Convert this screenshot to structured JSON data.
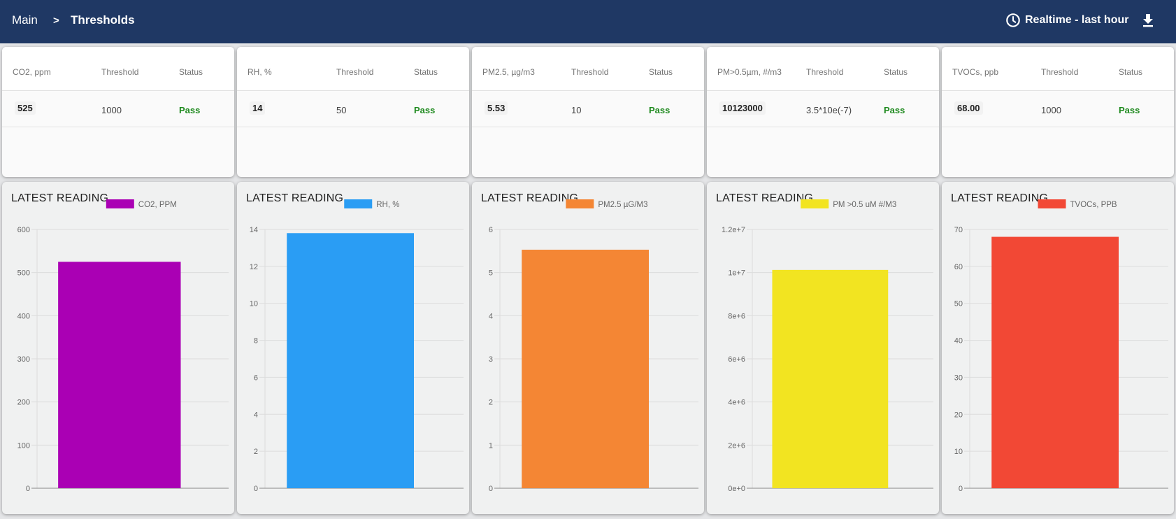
{
  "header": {
    "breadcrumb": [
      {
        "label": "Main"
      },
      {
        "label": ">"
      },
      {
        "label": "Thresholds"
      }
    ],
    "time_range_label": "Realtime - last hour",
    "time_range_icon": "clock-icon",
    "download_icon": "download-icon"
  },
  "threshold_cards": [
    {
      "metric": "CO2, ppm",
      "threshold_header": "Threshold",
      "status_header": "Status",
      "reading": "525",
      "threshold": "1000",
      "status": "Pass"
    },
    {
      "metric": "RH, %",
      "threshold_header": "Threshold",
      "status_header": "Status",
      "reading": "14",
      "threshold": "50",
      "status": "Pass"
    },
    {
      "metric": "PM2.5, µg/m3",
      "threshold_header": "Threshold",
      "status_header": "Status",
      "reading": "5.53",
      "threshold": "10",
      "status": "Pass"
    },
    {
      "metric": "PM>0.5µm, #/m3",
      "threshold_header": "Threshold",
      "status_header": "Status",
      "reading": "10123000",
      "threshold": "3.5*10e(-7)",
      "status": "Pass"
    },
    {
      "metric": "TVOCs, ppb",
      "threshold_header": "Threshold",
      "status_header": "Status",
      "reading": "68.00",
      "threshold": "1000",
      "status": "Pass"
    }
  ],
  "colors": {
    "header_bg": "#1f3864",
    "pass": "#1e8a1e",
    "grid": "#dcdcdc",
    "axis": "#888888"
  },
  "chart_data": [
    {
      "type": "bar",
      "title": "LATEST READING",
      "legend": "CO2, PPM",
      "legend_position": "top",
      "color": "#aa00b4",
      "categories": [
        ""
      ],
      "values": [
        525
      ],
      "ylim": [
        0,
        600
      ],
      "yticks": [
        "0",
        "100",
        "200",
        "300",
        "400",
        "500",
        "600"
      ],
      "ytick_values": [
        0,
        100,
        200,
        300,
        400,
        500,
        600
      ],
      "grid": true
    },
    {
      "type": "bar",
      "title": "LATEST READING",
      "legend": "RH, %",
      "legend_position": "top",
      "color": "#2a9df4",
      "categories": [
        ""
      ],
      "values": [
        13.8
      ],
      "ylim": [
        0,
        14
      ],
      "yticks": [
        "0",
        "2",
        "4",
        "6",
        "8",
        "10",
        "12",
        "14"
      ],
      "ytick_values": [
        0,
        2,
        4,
        6,
        8,
        10,
        12,
        14
      ],
      "grid": true
    },
    {
      "type": "bar",
      "title": "LATEST READING",
      "legend": "PM2.5 µG/M3",
      "legend_position": "top",
      "color": "#f48634",
      "categories": [
        ""
      ],
      "values": [
        5.53
      ],
      "ylim": [
        0,
        6
      ],
      "yticks": [
        "0",
        "1",
        "2",
        "3",
        "4",
        "5",
        "6"
      ],
      "ytick_values": [
        0,
        1,
        2,
        3,
        4,
        5,
        6
      ],
      "grid": true
    },
    {
      "type": "bar",
      "title": "LATEST READING",
      "legend": "PM >0.5 uM #/M3",
      "legend_position": "top",
      "color": "#f2e421",
      "categories": [
        ""
      ],
      "values": [
        10123000
      ],
      "ylim": [
        0,
        12000000
      ],
      "yticks": [
        "0e+0",
        "2e+6",
        "4e+6",
        "6e+6",
        "8e+6",
        "1e+7",
        "1.2e+7"
      ],
      "ytick_values": [
        0,
        2000000,
        4000000,
        6000000,
        8000000,
        10000000,
        12000000
      ],
      "grid": true
    },
    {
      "type": "bar",
      "title": "LATEST READING",
      "legend": "TVOCs, PPB",
      "legend_position": "top",
      "color": "#f24835",
      "categories": [
        ""
      ],
      "values": [
        68
      ],
      "ylim": [
        0,
        70
      ],
      "yticks": [
        "0",
        "10",
        "20",
        "30",
        "40",
        "50",
        "60",
        "70"
      ],
      "ytick_values": [
        0,
        10,
        20,
        30,
        40,
        50,
        60,
        70
      ],
      "grid": true
    }
  ]
}
